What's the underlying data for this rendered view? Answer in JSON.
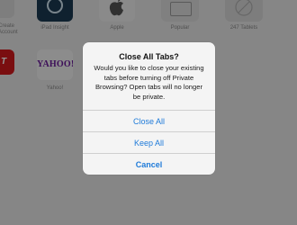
{
  "background_tiles": [
    {
      "label": "Create\nAccount",
      "label_visible": "Create Account"
    },
    {
      "label": "iPad Insight"
    },
    {
      "label": "Apple"
    },
    {
      "label": "Popular"
    },
    {
      "label": "247 Tablets"
    },
    {
      "label": "Yahoo!",
      "logo_text": "YAHOO!"
    },
    {
      "logo_text": "T"
    }
  ],
  "dialog": {
    "title": "Close All Tabs?",
    "message_lines": [
      "Would you like to close your existing",
      "tabs before turning off Private",
      "Browsing? Open tabs will no longer",
      "be private."
    ],
    "buttons": [
      {
        "label": "Close All"
      },
      {
        "label": "Keep All"
      },
      {
        "label": "Cancel"
      }
    ]
  },
  "colors": {
    "accent": "#1f7bd9",
    "yahoo": "#6a1b9a",
    "espn_red": "#d2191d"
  }
}
